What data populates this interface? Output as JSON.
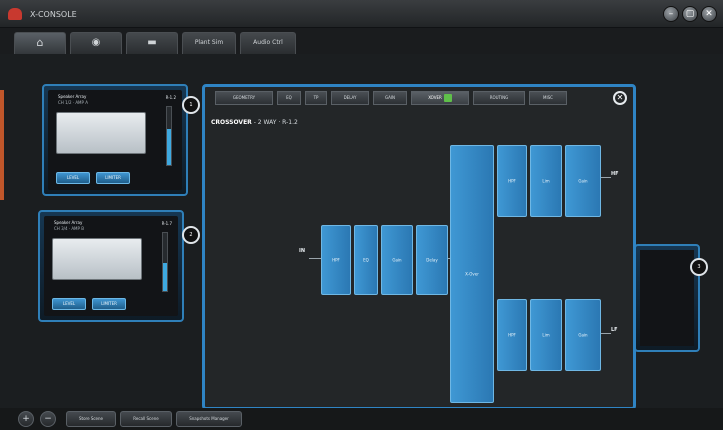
{
  "app": {
    "title": "X-CONSOLE"
  },
  "window": {
    "minimize": "–",
    "restore": "▢",
    "close": "✕"
  },
  "tabs": [
    {
      "label": "⌂",
      "name": "home"
    },
    {
      "label": "◉",
      "name": "devices"
    },
    {
      "label": "▬",
      "name": "layout"
    },
    {
      "label": "Plant Sim",
      "name": "plant-sim"
    },
    {
      "label": "Audio Ctrl",
      "name": "audio-ctrl"
    }
  ],
  "cards": [
    {
      "title": "Speaker Array",
      "subtitle": "CH 1/2 · AMP A",
      "model": "R-1.2",
      "meter_level": 0.62,
      "btn1": "LEVEL",
      "btn2": "LIMITER",
      "badge": "1"
    },
    {
      "title": "Speaker Array",
      "subtitle": "CH 3/4 · AMP B",
      "model": "R-1.7",
      "meter_level": 0.48,
      "btn1": "LEVEL",
      "btn2": "LIMITER",
      "badge": "2"
    }
  ],
  "right_card": {
    "badge": "3"
  },
  "modal": {
    "tabs": [
      "GEOMETRY",
      "EQ",
      "TP",
      "DELAY",
      "GAIN",
      "XOVER",
      "ROUTING",
      "MISC"
    ],
    "active_tab": "XOVER",
    "close": "✕",
    "header_bold": "CROSSOVER",
    "header_rest": "- 2 WAY · R-1.2",
    "input_label": "IN",
    "output_hf": "HF",
    "output_lf": "LF",
    "chain": [
      "HPF",
      "EQ",
      "Gain",
      "Delay"
    ],
    "split": "X-Over",
    "hf_chain": [
      "HPF",
      "Lim",
      "Gain"
    ],
    "lf_chain": [
      "HPF",
      "Lim",
      "Gain"
    ]
  },
  "toolbar": {
    "zoom_in": "+",
    "zoom_out": "−",
    "btn1": "Store Scene",
    "btn2": "Recall Scene",
    "btn3": "Snapshots Manager"
  }
}
